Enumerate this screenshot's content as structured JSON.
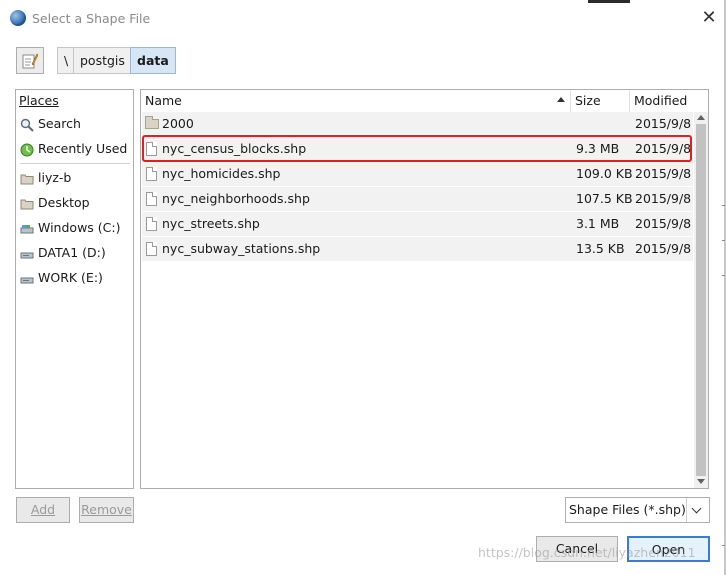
{
  "window": {
    "title": "Select a Shape File",
    "close_glyph": "✕"
  },
  "path_bar": {
    "edit_icon": "pencil-edit-icon",
    "crumbs": [
      "\\",
      "postgis",
      "data"
    ],
    "active_crumb": "data"
  },
  "places": {
    "header": "Places",
    "items": [
      {
        "label": "Search",
        "icon": "search-icon"
      },
      {
        "label": "Recently Used",
        "icon": "recent-icon"
      },
      {
        "label": "liyz-b",
        "icon": "folder-icon"
      },
      {
        "label": "Desktop",
        "icon": "folder-icon"
      },
      {
        "label": "Windows (C:)",
        "icon": "drive-icon"
      },
      {
        "label": "DATA1 (D:)",
        "icon": "drive-icon"
      },
      {
        "label": "WORK (E:)",
        "icon": "drive-icon"
      }
    ]
  },
  "files": {
    "columns": {
      "name": "Name",
      "size": "Size",
      "modified": "Modified"
    },
    "rows": [
      {
        "name": "2000",
        "size": "",
        "modified": "2015/9/8",
        "type": "folder"
      },
      {
        "name": "nyc_census_blocks.shp",
        "size": "9.3 MB",
        "modified": "2015/9/8",
        "type": "file",
        "selected": true
      },
      {
        "name": "nyc_homicides.shp",
        "size": "109.0 KB",
        "modified": "2015/9/8",
        "type": "file"
      },
      {
        "name": "nyc_neighborhoods.shp",
        "size": "107.5 KB",
        "modified": "2015/9/8",
        "type": "file"
      },
      {
        "name": "nyc_streets.shp",
        "size": "3.1 MB",
        "modified": "2015/9/8",
        "type": "file"
      },
      {
        "name": "nyc_subway_stations.shp",
        "size": "13.5 KB",
        "modified": "2015/9/8",
        "type": "file"
      }
    ]
  },
  "buttons": {
    "add": "Add",
    "remove": "Remove",
    "cancel": "Cancel",
    "open": "Open"
  },
  "filter": {
    "selected": "Shape Files (*.shp)"
  },
  "watermark": "https://blog.csdn.net/liyazhen2011",
  "colors": {
    "highlight_border": "#e02020",
    "primary_button_border": "#3a7bd5",
    "active_crumb_bg": "#d7e6f5"
  }
}
